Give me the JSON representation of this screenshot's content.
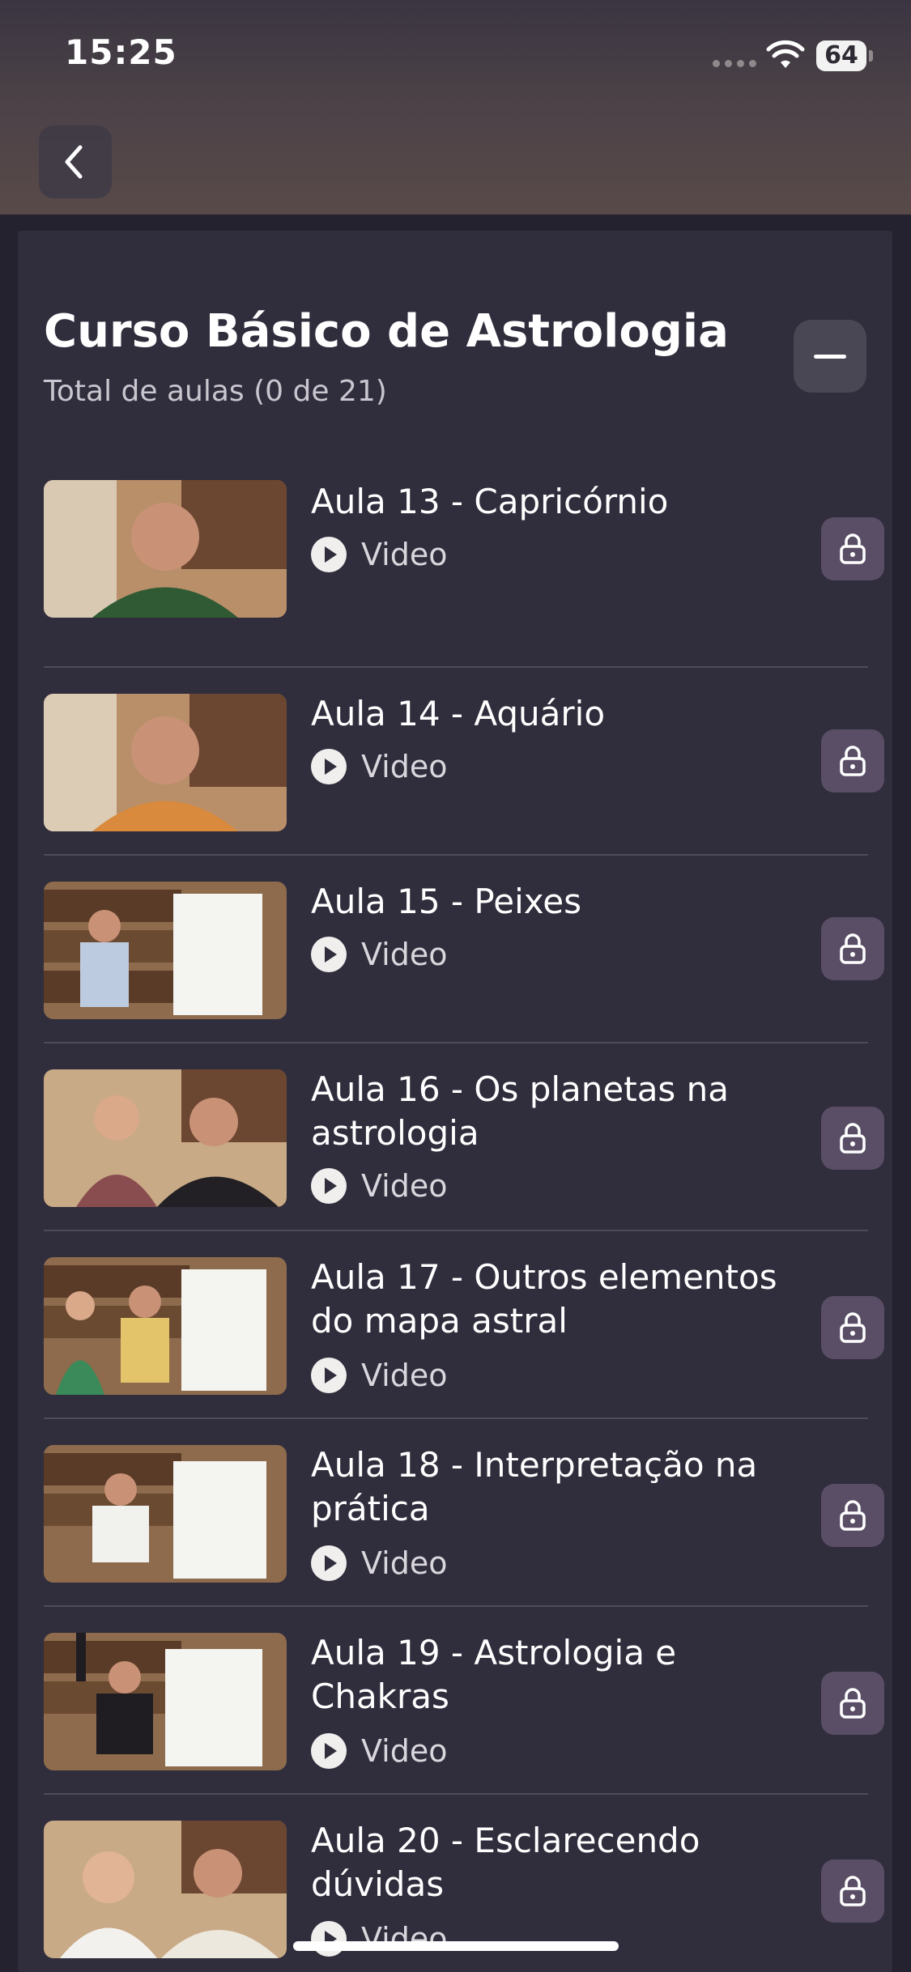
{
  "status_bar": {
    "time": "15:25",
    "battery": "64"
  },
  "course": {
    "title": "Curso Básico de Astrologia",
    "subtitle": "Total de aulas (0 de 21)"
  },
  "lessons": [
    {
      "title": "Aula 13 - Capricórnio",
      "type": "Video",
      "thumb": "man-green-shirt"
    },
    {
      "title": "Aula 14 - Aquário",
      "type": "Video",
      "thumb": "man-orange-shirt"
    },
    {
      "title": "Aula 15 - Peixes",
      "type": "Video",
      "thumb": "man-whiteboard"
    },
    {
      "title": "Aula 16 - Os planetas na astrologia",
      "type": "Video",
      "thumb": "woman-and-man"
    },
    {
      "title": "Aula 17 - Outros elementos do mapa astral",
      "type": "Video",
      "thumb": "two-people-whiteboard"
    },
    {
      "title": "Aula 18 - Interpretação na prática",
      "type": "Video",
      "thumb": "man-whiteboard-2"
    },
    {
      "title": "Aula 19 - Astrologia e Chakras",
      "type": "Video",
      "thumb": "man-raising-hand"
    },
    {
      "title": "Aula 20 - Esclarecendo dúvidas",
      "type": "Video",
      "thumb": "woman-and-man-2"
    }
  ],
  "colors": {
    "background": "#25222f",
    "card": "#302d3c",
    "lock_button": "#5a4e66",
    "collapse_button": "#4a4754"
  },
  "icons": {
    "back": "chevron-left-icon",
    "collapse": "minus-icon",
    "play": "play-icon",
    "lock": "lock-icon",
    "wifi": "wifi-icon",
    "battery": "battery-icon"
  }
}
